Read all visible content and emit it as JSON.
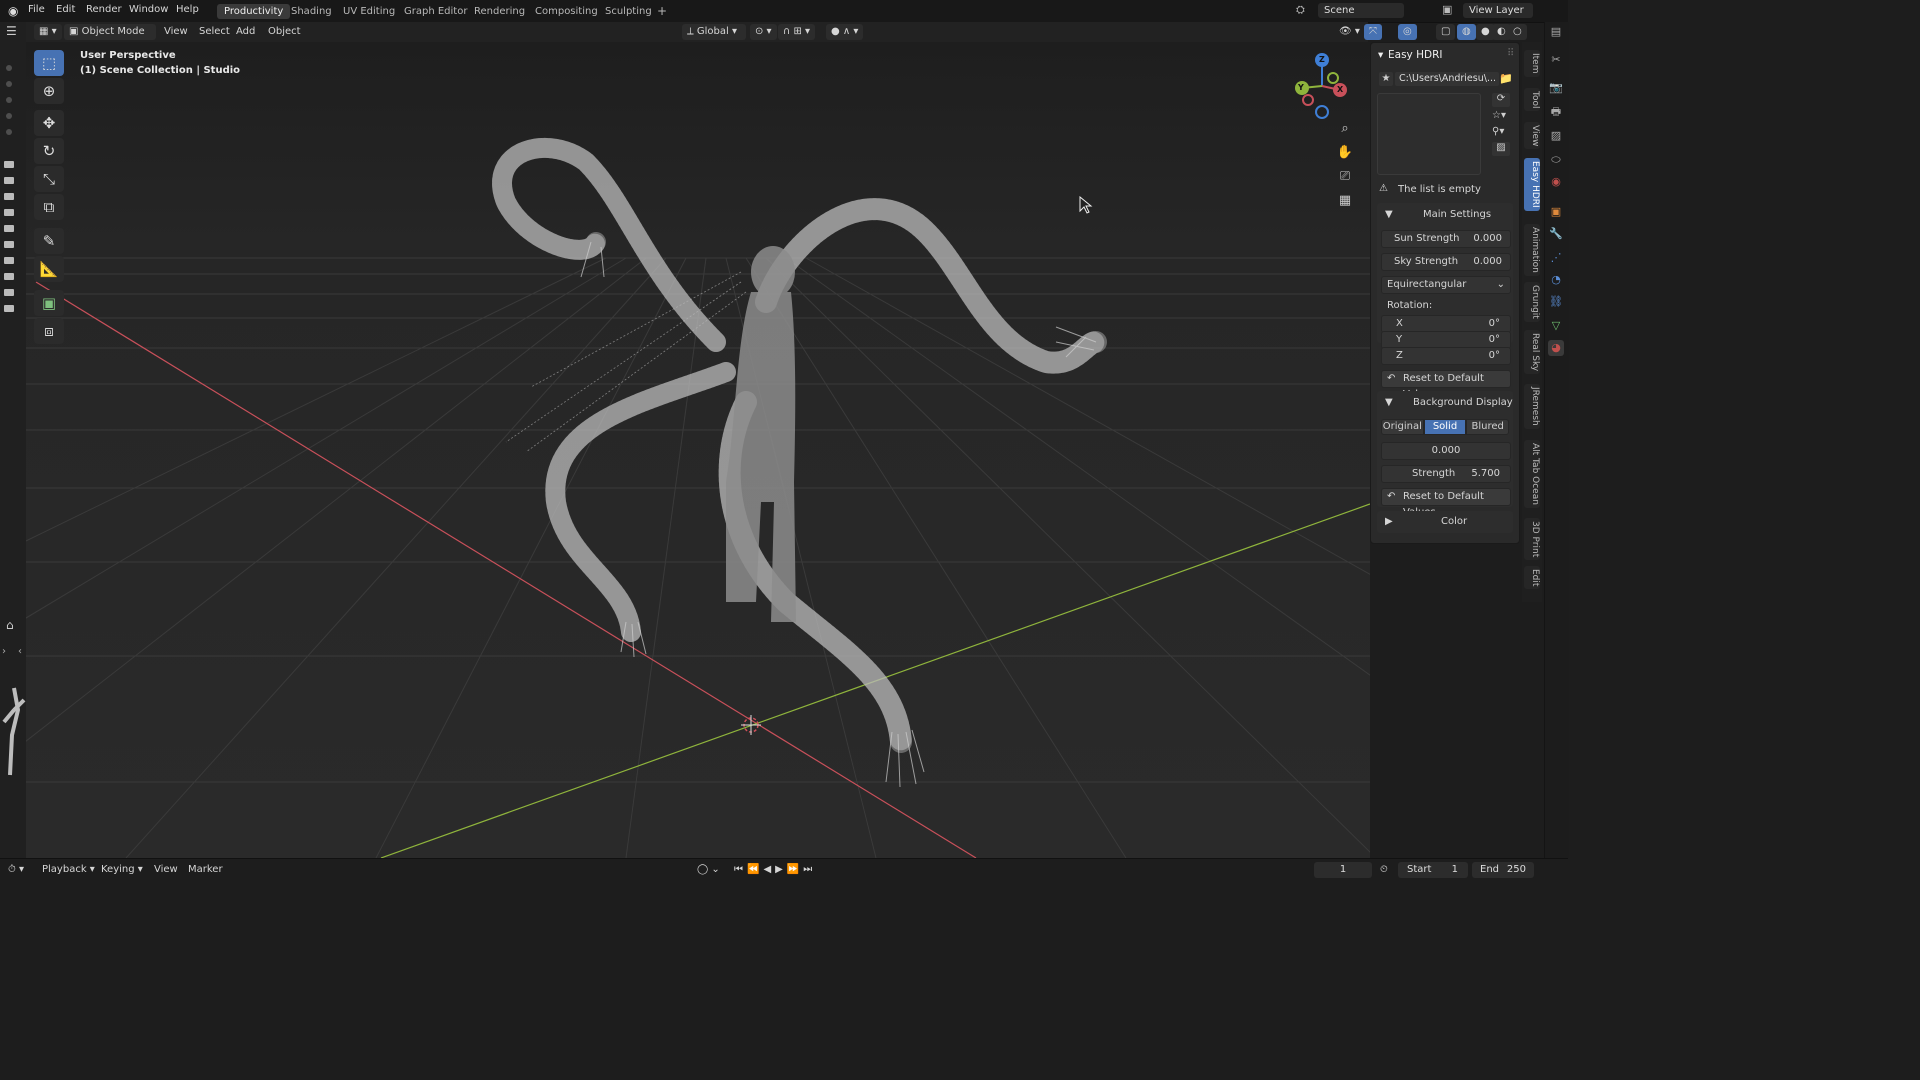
{
  "topbar": {
    "menus": [
      "File",
      "Edit",
      "Render",
      "Window",
      "Help"
    ],
    "workspaces": [
      "Productivity",
      "Shading",
      "UV Editing",
      "Graph Editor",
      "Rendering",
      "Compositing",
      "Sculpting"
    ],
    "active_workspace": "Productivity",
    "add_tab_glyph": "+",
    "scene_label": "Scene",
    "view_layer_label": "View Layer"
  },
  "header": {
    "mode": "Object Mode",
    "menus": [
      "View",
      "Select",
      "Add",
      "Object"
    ],
    "transform_orientation": "Global"
  },
  "viewport": {
    "perspective": "User Perspective",
    "collection": "(1) Scene Collection | Studio",
    "gizmo": {
      "x": "X",
      "y": "Y",
      "z": "Z"
    }
  },
  "npanel": {
    "title": "Easy HDRI",
    "path": "C:\\Users\\Andriesu\\...",
    "empty_message": "The list is empty",
    "main_settings": "Main Settings",
    "sun_strength_label": "Sun Strength",
    "sun_strength_value": "0.000",
    "sky_strength_label": "Sky Strength",
    "sky_strength_value": "0.000",
    "projection": "Equirectangular",
    "rotation_label": "Rotation:",
    "rot_x_label": "X",
    "rot_x_value": "0°",
    "rot_y_label": "Y",
    "rot_y_value": "0°",
    "rot_z_label": "Z",
    "rot_z_value": "0°",
    "reset_label": "Reset to Default Values",
    "background_display": "Background Display",
    "bg_modes": [
      "Original",
      "Solid",
      "Blured"
    ],
    "bg_active": "Solid",
    "bg_value": "0.000",
    "strength_label": "Strength",
    "strength_value": "5.700",
    "reset_label_2": "Reset to Default Values",
    "color_label": "Color"
  },
  "side_tabs": [
    "Item",
    "Tool",
    "View",
    "Easy HDRI",
    "Animation",
    "Grungit",
    "Real Sky",
    "JRemesh",
    "Alt Tab Ocean",
    "3D Print",
    "Edit"
  ],
  "active_side_tab": "Easy HDRI",
  "timeline": {
    "menus": [
      "Playback",
      "Keying",
      "View",
      "Marker"
    ],
    "current_frame": "1",
    "start_label": "Start",
    "start_value": "1",
    "end_label": "End",
    "end_value": "250"
  },
  "colors": {
    "accent": "#4772b3",
    "x_axis": "#c8505a",
    "y_axis": "#8fb43c",
    "z_axis": "#3f7fd6"
  }
}
